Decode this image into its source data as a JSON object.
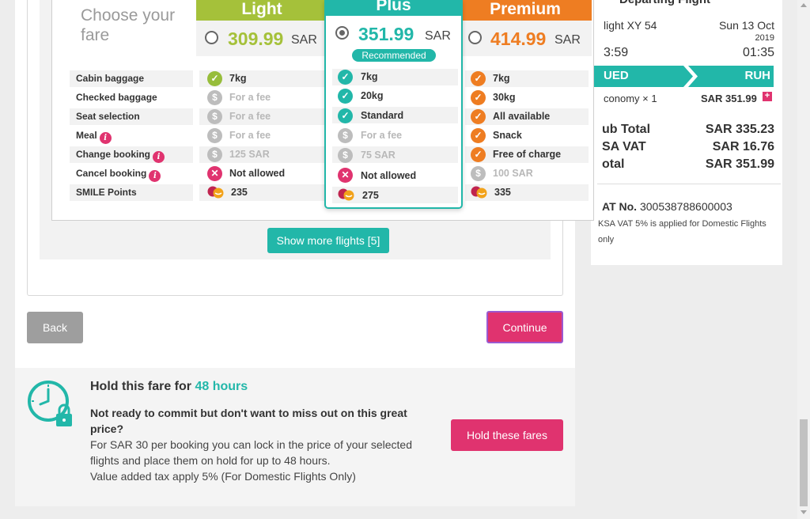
{
  "fare_table": {
    "choose_fare": "Choose your fare",
    "columns": [
      {
        "name": "Light",
        "price": "309.99",
        "currency": "SAR",
        "color": "#a5c13a",
        "selected": false
      },
      {
        "name": "Plus",
        "price": "351.99",
        "currency": "SAR",
        "color": "#22b7a9",
        "selected": true,
        "badge": "Recommended"
      },
      {
        "name": "Premium",
        "price": "414.99",
        "currency": "SAR",
        "color": "#ee7d22",
        "selected": false
      }
    ],
    "features": [
      {
        "label": "Cabin baggage",
        "info": false,
        "light": {
          "icon": "check-icon",
          "text": "7kg"
        },
        "plus": {
          "icon": "check-icon",
          "text": "7kg"
        },
        "premium": {
          "icon": "check-icon",
          "text": "7kg"
        }
      },
      {
        "label": "Checked baggage",
        "info": false,
        "light": {
          "icon": "dollar-icon",
          "text": "For a fee"
        },
        "plus": {
          "icon": "check-icon",
          "text": "20kg"
        },
        "premium": {
          "icon": "check-icon",
          "text": "30kg"
        }
      },
      {
        "label": "Seat selection",
        "info": false,
        "light": {
          "icon": "dollar-icon",
          "text": "For a fee"
        },
        "plus": {
          "icon": "check-icon",
          "text": "Standard"
        },
        "premium": {
          "icon": "check-icon",
          "text": "All available"
        }
      },
      {
        "label": "Meal",
        "info": true,
        "light": {
          "icon": "dollar-icon",
          "text": "For a fee"
        },
        "plus": {
          "icon": "dollar-icon",
          "text": "For a fee"
        },
        "premium": {
          "icon": "check-icon",
          "text": "Snack"
        }
      },
      {
        "label": "Change booking",
        "info": true,
        "light": {
          "icon": "dollar-icon",
          "text": "125 SAR"
        },
        "plus": {
          "icon": "dollar-icon",
          "text": "75 SAR"
        },
        "premium": {
          "icon": "check-icon",
          "text": "Free of charge"
        }
      },
      {
        "label": "Cancel booking",
        "info": true,
        "light": {
          "icon": "cross-icon",
          "text": "Not allowed"
        },
        "plus": {
          "icon": "cross-icon",
          "text": "Not allowed"
        },
        "premium": {
          "icon": "dollar-icon",
          "text": "100 SAR"
        }
      },
      {
        "label": "SMILE Points",
        "info": false,
        "light": {
          "icon": "smile-points-icon",
          "text": "235"
        },
        "plus": {
          "icon": "smile-points-icon",
          "text": "275"
        },
        "premium": {
          "icon": "smile-points-icon",
          "text": "335"
        }
      }
    ]
  },
  "show_more": "Show more flights [5]",
  "nav": {
    "back": "Back",
    "continue": "Continue"
  },
  "hold": {
    "title_prefix": "Hold this fare for ",
    "title_highlight": "48 hours",
    "question": "Not ready to commit but don't want to miss out on this great price?",
    "desc_line1": "For SAR 30 per booking you can lock in the price of your selected",
    "desc_line2": "flights and place them on hold for up to 48 hours.",
    "desc_line3": "Value added tax apply 5% (For Domestic Flights Only)",
    "button": "Hold these fares"
  },
  "summary": {
    "header_partial": "Departing Flight",
    "flight": "light XY 54",
    "date": "Sun 13 Oct",
    "year": "2019",
    "dep_time": "3:59",
    "arr_time": "01:35",
    "from": "UED",
    "to": "RUH",
    "fare_line": "conomy × 1",
    "fare_amount": "SAR 351.99",
    "sub_total_label": "ub Total",
    "sub_total": "SAR 335.23",
    "vat_label": "SA VAT",
    "vat": "SAR 16.76",
    "total_label": "otal",
    "total": "SAR 351.99",
    "vat_no_label": "AT No.",
    "vat_no": "300538788600003",
    "vat_note": "KSA VAT 5% is applied for Domestic Flights only"
  },
  "colors": {
    "teal": "#22b7a9",
    "pink": "#e0336f",
    "green": "#a5c13a",
    "orange": "#ee7d22"
  }
}
